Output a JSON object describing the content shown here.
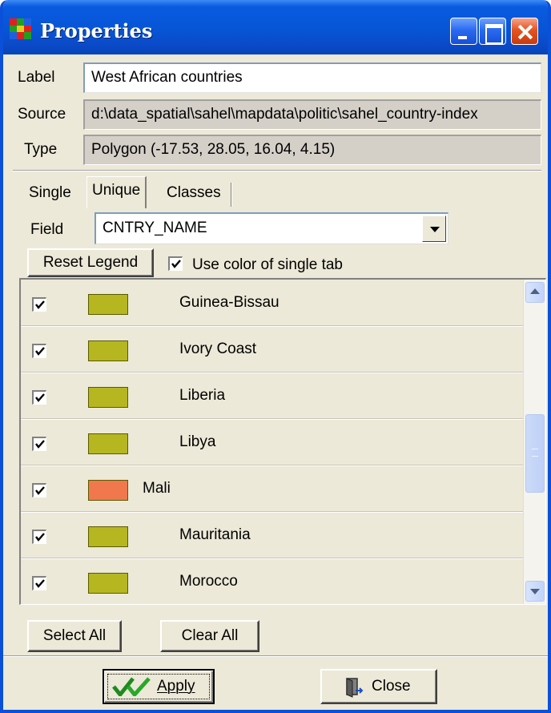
{
  "window": {
    "title": "Properties",
    "icon": "app-grid-icon",
    "controls": [
      "minimize-icon",
      "maximize-icon",
      "close-icon"
    ]
  },
  "layer": {
    "label_caption": "Label",
    "label_value": "West African countries",
    "source_caption": "Source",
    "source_value": "d:\\data_spatial\\sahel\\mapdata\\politic\\sahel_country-index",
    "type_caption": "Type",
    "type_value": "Polygon  (-17.53, 28.05, 16.04, 4.15)"
  },
  "tabs": [
    {
      "label": "Single"
    },
    {
      "label": "Unique"
    },
    {
      "label": "Classes"
    }
  ],
  "active_tab": "Unique",
  "field": {
    "caption": "Field",
    "selected": "CNTRY_NAME"
  },
  "legend": {
    "reset_label": "Reset Legend",
    "use_single_color_label": "Use color of single tab",
    "use_single_color_checked": true
  },
  "list": {
    "rows": [
      {
        "label": "Guinea-Bissau",
        "color": "#b6b620",
        "checked": true
      },
      {
        "label": "Ivory Coast",
        "color": "#b6b620",
        "checked": true
      },
      {
        "label": "Liberia",
        "color": "#b6b620",
        "checked": true
      },
      {
        "label": "Libya",
        "color": "#b6b620",
        "checked": true
      },
      {
        "label": "Mali",
        "color": "#f0784c",
        "checked": true
      },
      {
        "label": "Mauritania",
        "color": "#b6b620",
        "checked": true
      },
      {
        "label": "Morocco",
        "color": "#b6b620",
        "checked": true
      }
    ]
  },
  "actions": {
    "select_all": "Select All",
    "clear_all": "Clear All",
    "apply": "Apply",
    "close": "Close"
  },
  "colors": {
    "title_bar": "#0755d6",
    "dialog_face": "#ece9d8",
    "swatch_default": "#b6b620",
    "swatch_highlight": "#f0784c"
  }
}
